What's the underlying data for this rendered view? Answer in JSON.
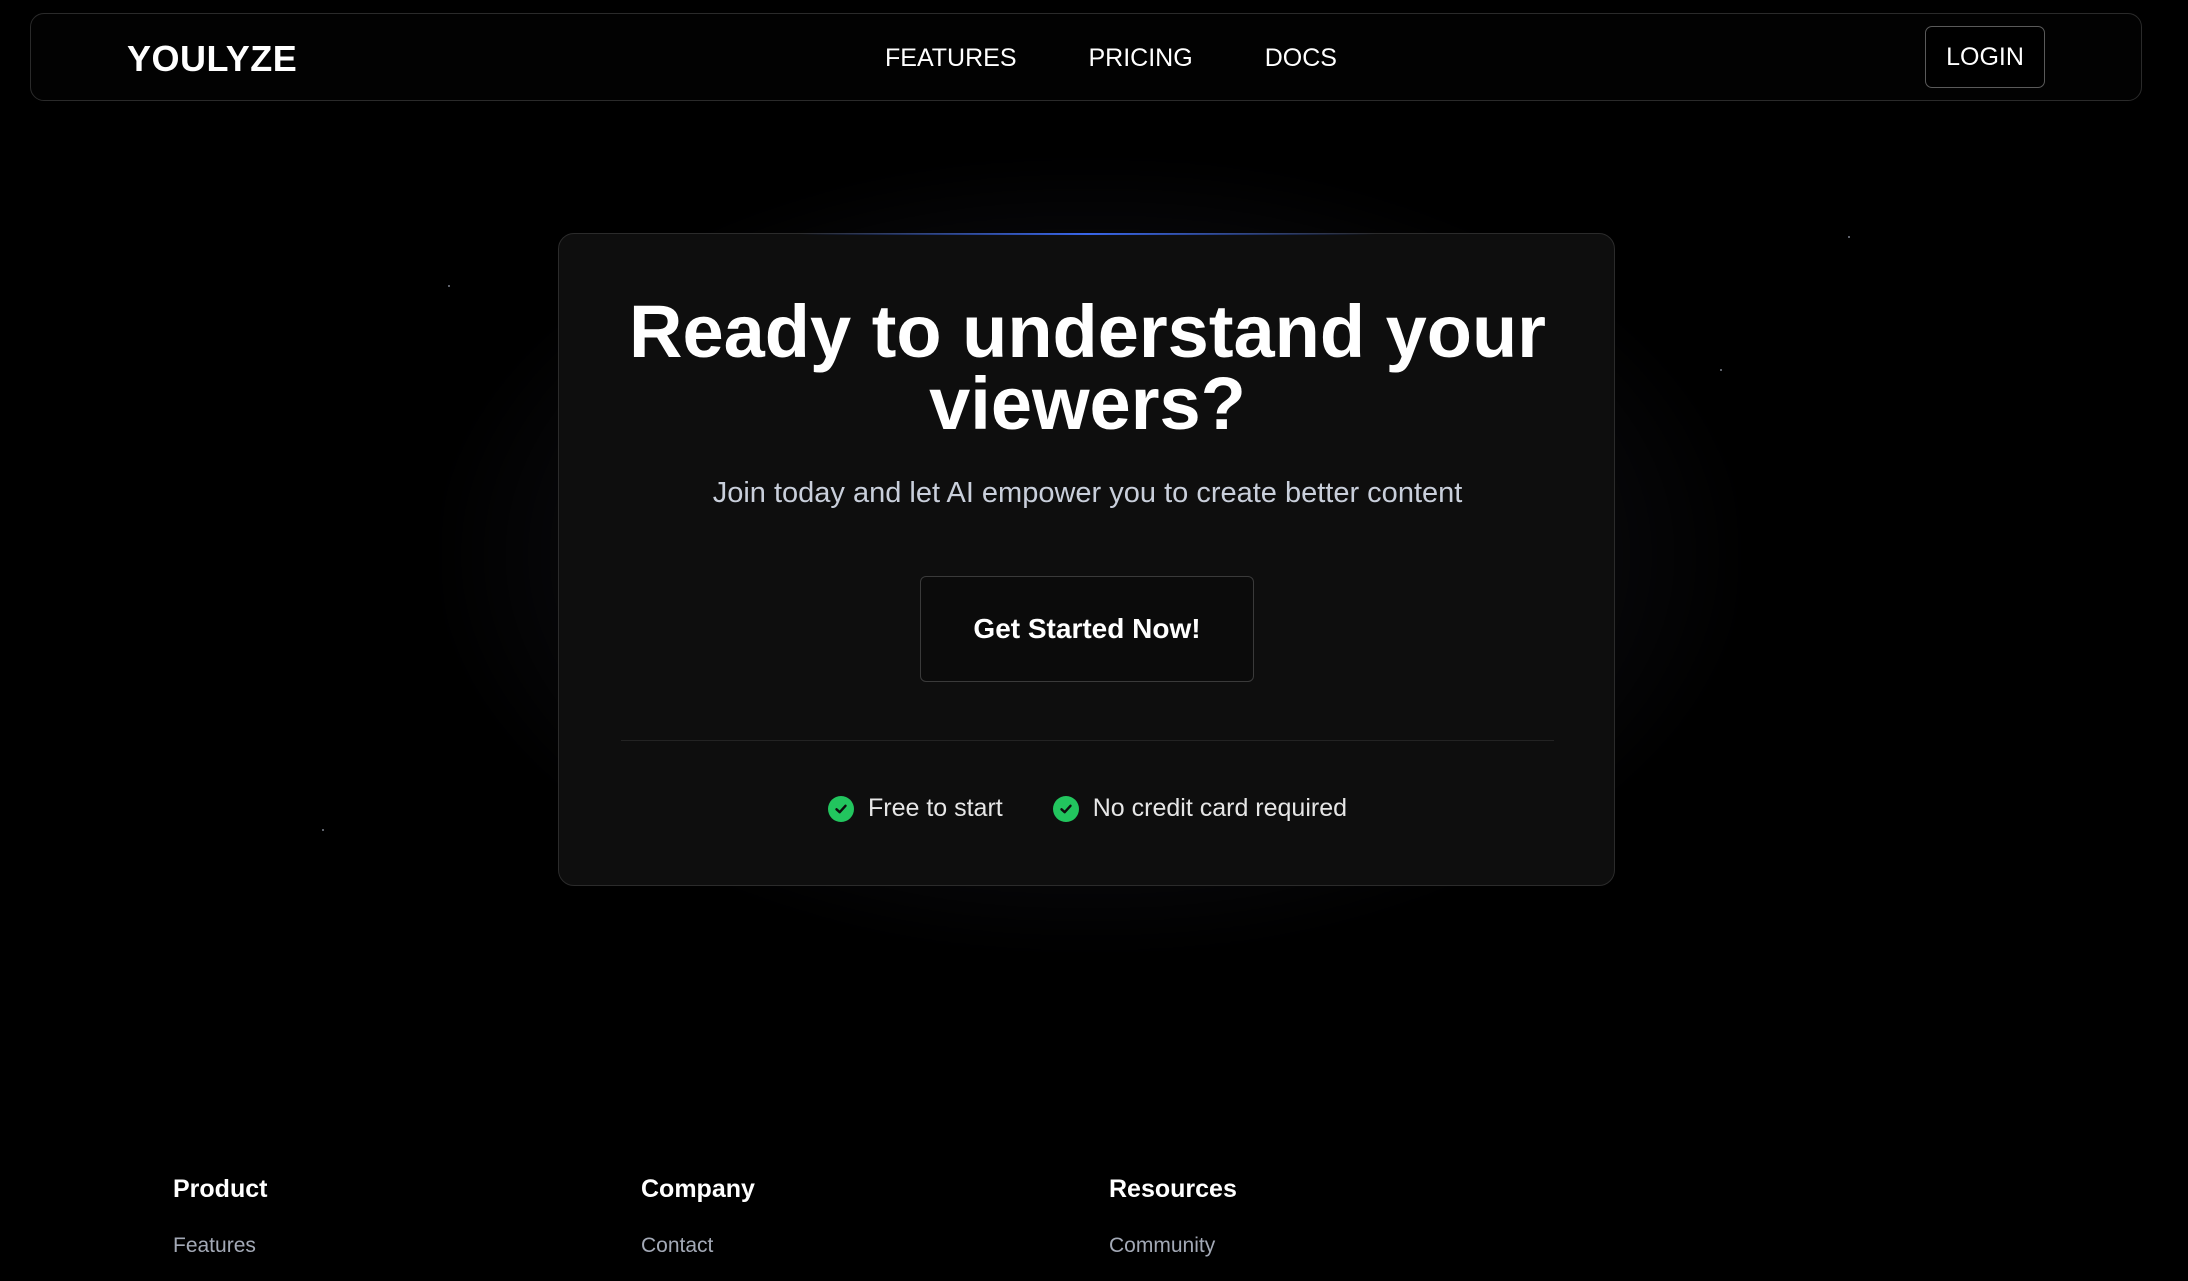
{
  "nav": {
    "brand": "YOULYZE",
    "links": [
      "FEATURES",
      "PRICING",
      "DOCS"
    ],
    "login_label": "LOGIN"
  },
  "hero": {
    "headline": "Ready to understand your viewers?",
    "subline": "Join today and let AI empower you to create better content",
    "cta_label": "Get Started Now!",
    "perks": [
      "Free to start",
      "No credit card required"
    ],
    "check_color": "#22c55e"
  },
  "footer": {
    "columns": [
      {
        "heading": "Product",
        "links": [
          "Features"
        ]
      },
      {
        "heading": "Company",
        "links": [
          "Contact"
        ]
      },
      {
        "heading": "Resources",
        "links": [
          "Community"
        ]
      }
    ]
  }
}
